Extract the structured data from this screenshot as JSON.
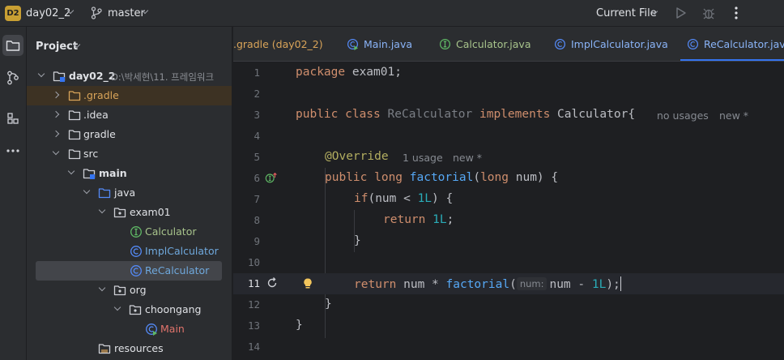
{
  "topbar": {
    "project_badge": "D2",
    "project_name": "day02_2",
    "branch": "master",
    "run_config": "Current File"
  },
  "project_panel": {
    "title": "Project",
    "tree": [
      {
        "label": "day02_2",
        "path": "D:\\박세현\\11. 프레임워크"
      },
      {
        "label": ".gradle"
      },
      {
        "label": ".idea"
      },
      {
        "label": "gradle"
      },
      {
        "label": "src"
      },
      {
        "label": "main"
      },
      {
        "label": "java"
      },
      {
        "label": "exam01"
      },
      {
        "label": "Calculator"
      },
      {
        "label": "ImplCalculator"
      },
      {
        "label": "ReCalculator"
      },
      {
        "label": "org"
      },
      {
        "label": "choongang"
      },
      {
        "label": "Main"
      },
      {
        "label": "resources"
      }
    ]
  },
  "tabs": [
    {
      "label": ".gradle (day02_2)"
    },
    {
      "label": "Main.java"
    },
    {
      "label": "Calculator.java"
    },
    {
      "label": "ImplCalculator.java"
    },
    {
      "label": "ReCalculator.java",
      "active": true
    }
  ],
  "editor": {
    "line_numbers": [
      "1",
      "2",
      "3",
      "4",
      "5",
      "6",
      "7",
      "8",
      "9",
      "10",
      "11",
      "12",
      "13",
      "14"
    ],
    "current_line": "11",
    "code": {
      "l1": {
        "kw": "package",
        "rest": " exam01;"
      },
      "l3": {
        "kw1": "public class ",
        "cls": "ReCalculator",
        "kw2": " implements ",
        "iface": "Calculator{",
        "hint1": "no usages",
        "hint2": "new *"
      },
      "l5": {
        "anno": "@Override",
        "hint1": "1 usage",
        "hint2": "new *"
      },
      "l6": {
        "kw1": "public long ",
        "fn": "factorial",
        "p1": "(",
        "kw2": "long",
        "p2": " num) {"
      },
      "l7": {
        "kw": "if",
        "p1": "(num < ",
        "num": "1L",
        "p2": ") {"
      },
      "l8": {
        "kw": "return ",
        "num": "1L",
        "p": ";"
      },
      "l9": {
        "text": "}"
      },
      "l11": {
        "kw": "return",
        "p1": " num * ",
        "fn": "factorial",
        "p2": "(",
        "inlay": "num:",
        "p3": "num - ",
        "num": "1L",
        "p4": ");"
      },
      "l12": {
        "text": "}"
      },
      "l13": {
        "text": "}"
      }
    }
  }
}
